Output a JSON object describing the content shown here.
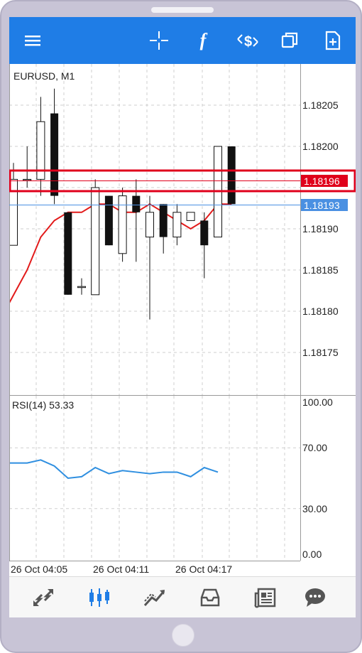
{
  "toolbar": {
    "icons": [
      "menu-icon",
      "crosshair-icon",
      "indicators-icon",
      "objects-icon",
      "windows-icon",
      "new-order-icon"
    ],
    "function_glyph": "f"
  },
  "chart": {
    "symbol_label": "EURUSD, M1",
    "price_ticks": [
      "1.18205",
      "1.18200",
      "1.18190",
      "1.18185",
      "1.18180",
      "1.18175"
    ],
    "bid_price": "1.18196",
    "ask_price": "1.18193",
    "colors": {
      "bid": "#e0001b",
      "ask": "#4a90e2",
      "ma": "#e21a1a",
      "rsi": "#2f8fe0",
      "accent": "#1f7de6"
    }
  },
  "rsi": {
    "label": "RSI(14) 53.33",
    "ticks": [
      "100.00",
      "70.00",
      "30.00",
      "0.00"
    ]
  },
  "time_axis": [
    "26 Oct 04:05",
    "26 Oct 04:11",
    "26 Oct 04:17"
  ],
  "bottom_nav": {
    "icons": [
      "quotes-icon",
      "chart-icon",
      "trade-icon",
      "history-icon",
      "news-icon",
      "chat-icon"
    ],
    "active": "chart-icon"
  },
  "chart_data": {
    "type": "candlestick",
    "symbol": "EURUSD",
    "timeframe": "M1",
    "ylim": [
      1.1817,
      1.1821
    ],
    "candles": [
      {
        "o": 1.18188,
        "h": 1.18198,
        "l": 1.18188,
        "c": 1.18196
      },
      {
        "o": 1.18196,
        "h": 1.182,
        "l": 1.18195,
        "c": 1.18196
      },
      {
        "o": 1.18196,
        "h": 1.18206,
        "l": 1.18194,
        "c": 1.18203
      },
      {
        "o": 1.18204,
        "h": 1.18207,
        "l": 1.18193,
        "c": 1.18194
      },
      {
        "o": 1.18192,
        "h": 1.18192,
        "l": 1.18182,
        "c": 1.18182
      },
      {
        "o": 1.18183,
        "h": 1.18184,
        "l": 1.18182,
        "c": 1.18183
      },
      {
        "o": 1.18182,
        "h": 1.18196,
        "l": 1.18182,
        "c": 1.18195
      },
      {
        "o": 1.18194,
        "h": 1.18194,
        "l": 1.18188,
        "c": 1.18188
      },
      {
        "o": 1.18187,
        "h": 1.18195,
        "l": 1.18186,
        "c": 1.18194
      },
      {
        "o": 1.18194,
        "h": 1.18196,
        "l": 1.18186,
        "c": 1.18192
      },
      {
        "o": 1.18189,
        "h": 1.18194,
        "l": 1.18179,
        "c": 1.18192
      },
      {
        "o": 1.18193,
        "h": 1.18193,
        "l": 1.18187,
        "c": 1.18189
      },
      {
        "o": 1.18189,
        "h": 1.18193,
        "l": 1.18188,
        "c": 1.18192
      },
      {
        "o": 1.18191,
        "h": 1.18192,
        "l": 1.18191,
        "c": 1.18192
      },
      {
        "o": 1.18191,
        "h": 1.18192,
        "l": 1.18184,
        "c": 1.18188
      },
      {
        "o": 1.18189,
        "h": 1.182,
        "l": 1.18189,
        "c": 1.182
      },
      {
        "o": 1.182,
        "h": 1.182,
        "l": 1.18193,
        "c": 1.18193
      }
    ],
    "ma_values": [
      1.18181,
      1.18185,
      1.18189,
      1.18191,
      1.18192,
      1.18192,
      1.18193,
      1.18193,
      1.18192,
      1.18192,
      1.18193,
      1.18192,
      1.18191,
      1.1819,
      1.18191,
      1.18193,
      1.18193
    ],
    "rsi_values": [
      60,
      60,
      62,
      58,
      50,
      51,
      57,
      53,
      55,
      54,
      53,
      54,
      54,
      51,
      57,
      54
    ],
    "rsi_ylim": [
      0,
      100
    ]
  }
}
